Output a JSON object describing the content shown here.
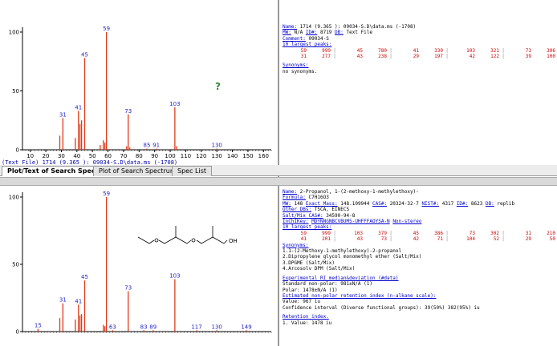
{
  "top": {
    "chart_data": {
      "type": "bar",
      "xlim": [
        5,
        165
      ],
      "ylim": [
        0,
        100
      ],
      "x_ticks": [
        10,
        20,
        30,
        40,
        50,
        60,
        70,
        80,
        90,
        100,
        110,
        120,
        130,
        140,
        150,
        160
      ],
      "y_ticks": [
        0,
        50,
        100
      ],
      "y_tick_labels": [
        "0",
        "50",
        "100"
      ],
      "peaks": [
        {
          "x": 29,
          "y": 12
        },
        {
          "x": 31,
          "y": 27
        },
        {
          "x": 39,
          "y": 10
        },
        {
          "x": 41,
          "y": 33
        },
        {
          "x": 42,
          "y": 22
        },
        {
          "x": 43,
          "y": 25
        },
        {
          "x": 45,
          "y": 78
        },
        {
          "x": 55,
          "y": 4
        },
        {
          "x": 57,
          "y": 8
        },
        {
          "x": 58,
          "y": 6
        },
        {
          "x": 59,
          "y": 100
        },
        {
          "x": 72,
          "y": 3
        },
        {
          "x": 73,
          "y": 30
        },
        {
          "x": 74,
          "y": 2
        },
        {
          "x": 85,
          "y": 1
        },
        {
          "x": 91,
          "y": 1
        },
        {
          "x": 103,
          "y": 36
        },
        {
          "x": 104,
          "y": 3
        },
        {
          "x": 130,
          "y": 1
        }
      ],
      "peak_labels": [
        {
          "x": 31,
          "y": 27,
          "text": "31"
        },
        {
          "x": 41,
          "y": 33,
          "text": "41"
        },
        {
          "x": 45,
          "y": 78,
          "text": "45"
        },
        {
          "x": 59,
          "y": 100,
          "text": "59"
        },
        {
          "x": 73,
          "y": 30,
          "text": "73"
        },
        {
          "x": 85,
          "y": 1,
          "text": "85"
        },
        {
          "x": 91,
          "y": 1,
          "text": "91"
        },
        {
          "x": 103,
          "y": 36,
          "text": "103"
        },
        {
          "x": 130,
          "y": 1,
          "text": "130"
        }
      ]
    },
    "question_mark": "?",
    "caption": "(Text File) 1714 (9.365 ): 09034-S.D\\data.ms (-1708)",
    "info": {
      "name_label": "Name:",
      "name_value": " 1714 (9.365 ): 09034-S.D\\data.ms (-1708)",
      "mw_label": "MW:",
      "mw_value": " N/A ",
      "id_label": "ID#:",
      "id_value": " 8719 ",
      "db_label": "DB:",
      "db_value": " Text File",
      "comment_label": "Comment:",
      "comment_value": " 09034-S",
      "largest_label": "10 largest peaks:",
      "peaks_row1": [
        "59",
        "999",
        "45",
        "780",
        "41",
        "330",
        "103",
        "321",
        "73",
        "306"
      ],
      "peaks_row2": [
        "31",
        "277",
        "43",
        "238",
        "29",
        "197",
        "42",
        "122",
        "39",
        "100"
      ],
      "synonyms_label": "Synonyms:",
      "synonyms_value": "no synonyms."
    }
  },
  "tabs": {
    "tab1": "Plot/Text of Search Spectrum",
    "tab2": "Plot of Search Spectrum",
    "tab3": "Spec List"
  },
  "bottom": {
    "chart_data": {
      "type": "bar",
      "xlim": [
        5,
        165
      ],
      "ylim": [
        0,
        100
      ],
      "y_ticks": [
        0,
        50,
        100
      ],
      "y_tick_labels": [
        "0",
        "50",
        "100"
      ],
      "peaks": [
        {
          "x": 15,
          "y": 2
        },
        {
          "x": 29,
          "y": 10
        },
        {
          "x": 31,
          "y": 21
        },
        {
          "x": 39,
          "y": 9
        },
        {
          "x": 41,
          "y": 20
        },
        {
          "x": 42,
          "y": 12
        },
        {
          "x": 43,
          "y": 13
        },
        {
          "x": 45,
          "y": 38
        },
        {
          "x": 57,
          "y": 5
        },
        {
          "x": 58,
          "y": 4
        },
        {
          "x": 59,
          "y": 100
        },
        {
          "x": 63,
          "y": 1
        },
        {
          "x": 73,
          "y": 30
        },
        {
          "x": 83,
          "y": 1
        },
        {
          "x": 89,
          "y": 1
        },
        {
          "x": 103,
          "y": 39
        },
        {
          "x": 117,
          "y": 1
        },
        {
          "x": 130,
          "y": 1
        },
        {
          "x": 149,
          "y": 1
        }
      ],
      "peak_labels": [
        {
          "x": 15,
          "y": 2,
          "text": "15"
        },
        {
          "x": 31,
          "y": 21,
          "text": "31"
        },
        {
          "x": 41,
          "y": 20,
          "text": "41"
        },
        {
          "x": 45,
          "y": 38,
          "text": "45"
        },
        {
          "x": 59,
          "y": 100,
          "text": "59"
        },
        {
          "x": 63,
          "y": 1,
          "text": "63"
        },
        {
          "x": 73,
          "y": 30,
          "text": "73"
        },
        {
          "x": 83,
          "y": 1,
          "text": "83"
        },
        {
          "x": 89,
          "y": 1,
          "text": "89"
        },
        {
          "x": 103,
          "y": 39,
          "text": "103"
        },
        {
          "x": 117,
          "y": 1,
          "text": "117"
        },
        {
          "x": 130,
          "y": 1,
          "text": "130"
        },
        {
          "x": 149,
          "y": 1,
          "text": "149"
        }
      ]
    },
    "structure_oh": "OH",
    "info": {
      "name_label": "Name:",
      "name_value": " 2-Propanol, 1-(2-methoxy-1-methylethoxy)-",
      "formula_label": "Formula:",
      "formula_value": " C7H16O3",
      "mw_label": "MW:",
      "mw_value": " 148 ",
      "exact_label": "Exact Mass:",
      "exact_value": " 148.109944 ",
      "cas_label": "CAS#:",
      "cas_value": " 20324-32-7 ",
      "nist_label": "NIST#:",
      "nist_value": " 4317 ",
      "id_label": "ID#:",
      "id_value": " 8623 ",
      "db_label": "DB:",
      "db_value": " replib",
      "other_label": "Other DBs:",
      "other_value": " TSCA, EINECS",
      "salt_label": "Salt/Mix CAS#:",
      "salt_value": " 34590-94-8",
      "inchikey_label": "InChIKey:",
      "inchikey_value": "MDYNNGNBCVBUMS-UHFFFAOYSA-N",
      "nonstereo": "Non-stereo",
      "largest_label": "10 largest peaks:",
      "peaks_row1": [
        "59",
        "999",
        "103",
        "379",
        "45",
        "386",
        "73",
        "302",
        "31",
        "210"
      ],
      "peaks_row2": [
        "41",
        "201",
        "43",
        "73",
        "42",
        "71",
        "104",
        "52",
        "29",
        "50"
      ],
      "synonyms_label": "Synonyms:",
      "synonyms": [
        "1.1-(2-Methoxy-1-methylethoxy)-2-propanol",
        "2.Dipropylene glycol monomethyl ether (Salt/Mix)",
        "3.DPGME (Salt/Mix)",
        "4.Arcosolv DPM (Salt/Mix)"
      ],
      "ri_label": "Experimental RI median&deviation (#data)",
      "ri_rows": [
        "Standard non-polar:          981±N/A (1)",
        "Polar:                       1478±N/A (1)"
      ],
      "est_label": "Estimated non-polar retention index (n-alkane scale):",
      "est_value": "Value: 967 iu",
      "conf_value": "Confidence interval (Diverse functional groups):  39(50%) 382(95%) iu",
      "ret_label": "Retention index.",
      "ret_value": "1. Value: 1478 iu"
    }
  }
}
